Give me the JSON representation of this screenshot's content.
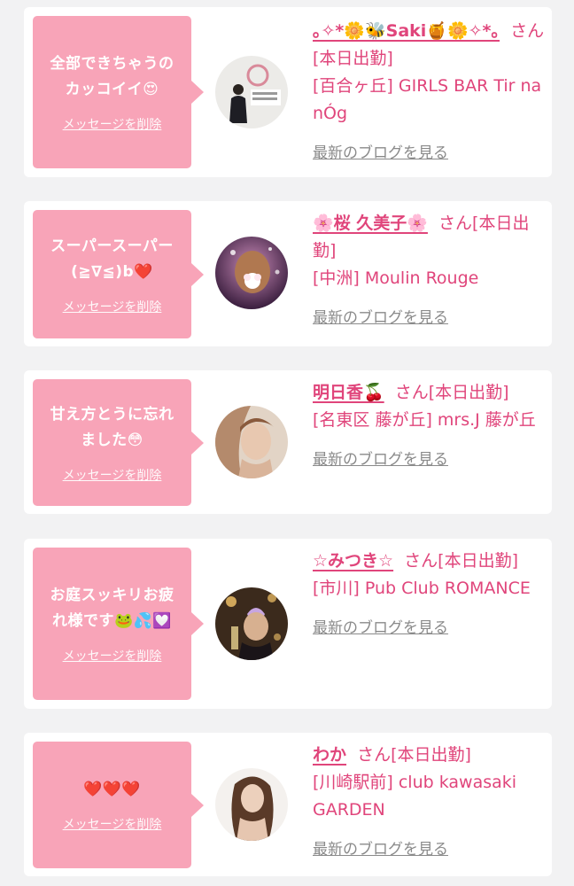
{
  "delete_label": "メッセージを削除",
  "blog_label": "最新のブログを見る",
  "colors": {
    "page_bg": "#f2f2f3",
    "bubble": "#f8a4b8",
    "accent": "#e0457b",
    "muted": "#8a8a8a"
  },
  "messages": [
    {
      "text": "全部できちゃうの\nカッコイイ😍",
      "name": "｡✧*🌼🐝Saki🍯🌼✧*｡",
      "honorific": "さん[本日出勤]",
      "shop": "[百合ヶ丘] GIRLS BAR Tir na nÓg",
      "avatar_icon": "profile-photo"
    },
    {
      "text": "スーパースーパー\n(≧∇≦)b❤️",
      "name": "🌸桜 久美子🌸",
      "honorific": "さん[本日出勤]",
      "shop": "[中洲] Moulin Rouge",
      "avatar_icon": "profile-photo"
    },
    {
      "text": "甘え方とうに忘れ\nました😳",
      "name": "明日香🍒",
      "honorific": "さん[本日出勤]",
      "shop": "[名東区 藤が丘] mrs.J 藤が丘",
      "avatar_icon": "profile-photo"
    },
    {
      "text": "お庭スッキリお疲\nれ様です🐸💦💟",
      "name": "☆みつき☆",
      "honorific": "さん[本日出勤]",
      "shop": "[市川] Pub Club ROMANCE",
      "avatar_icon": "profile-photo"
    },
    {
      "text": "❤️❤️❤️",
      "name": "わか",
      "honorific": "さん[本日出勤]",
      "shop": "[川崎駅前] club kawasaki GARDEN",
      "avatar_icon": "profile-photo"
    }
  ]
}
